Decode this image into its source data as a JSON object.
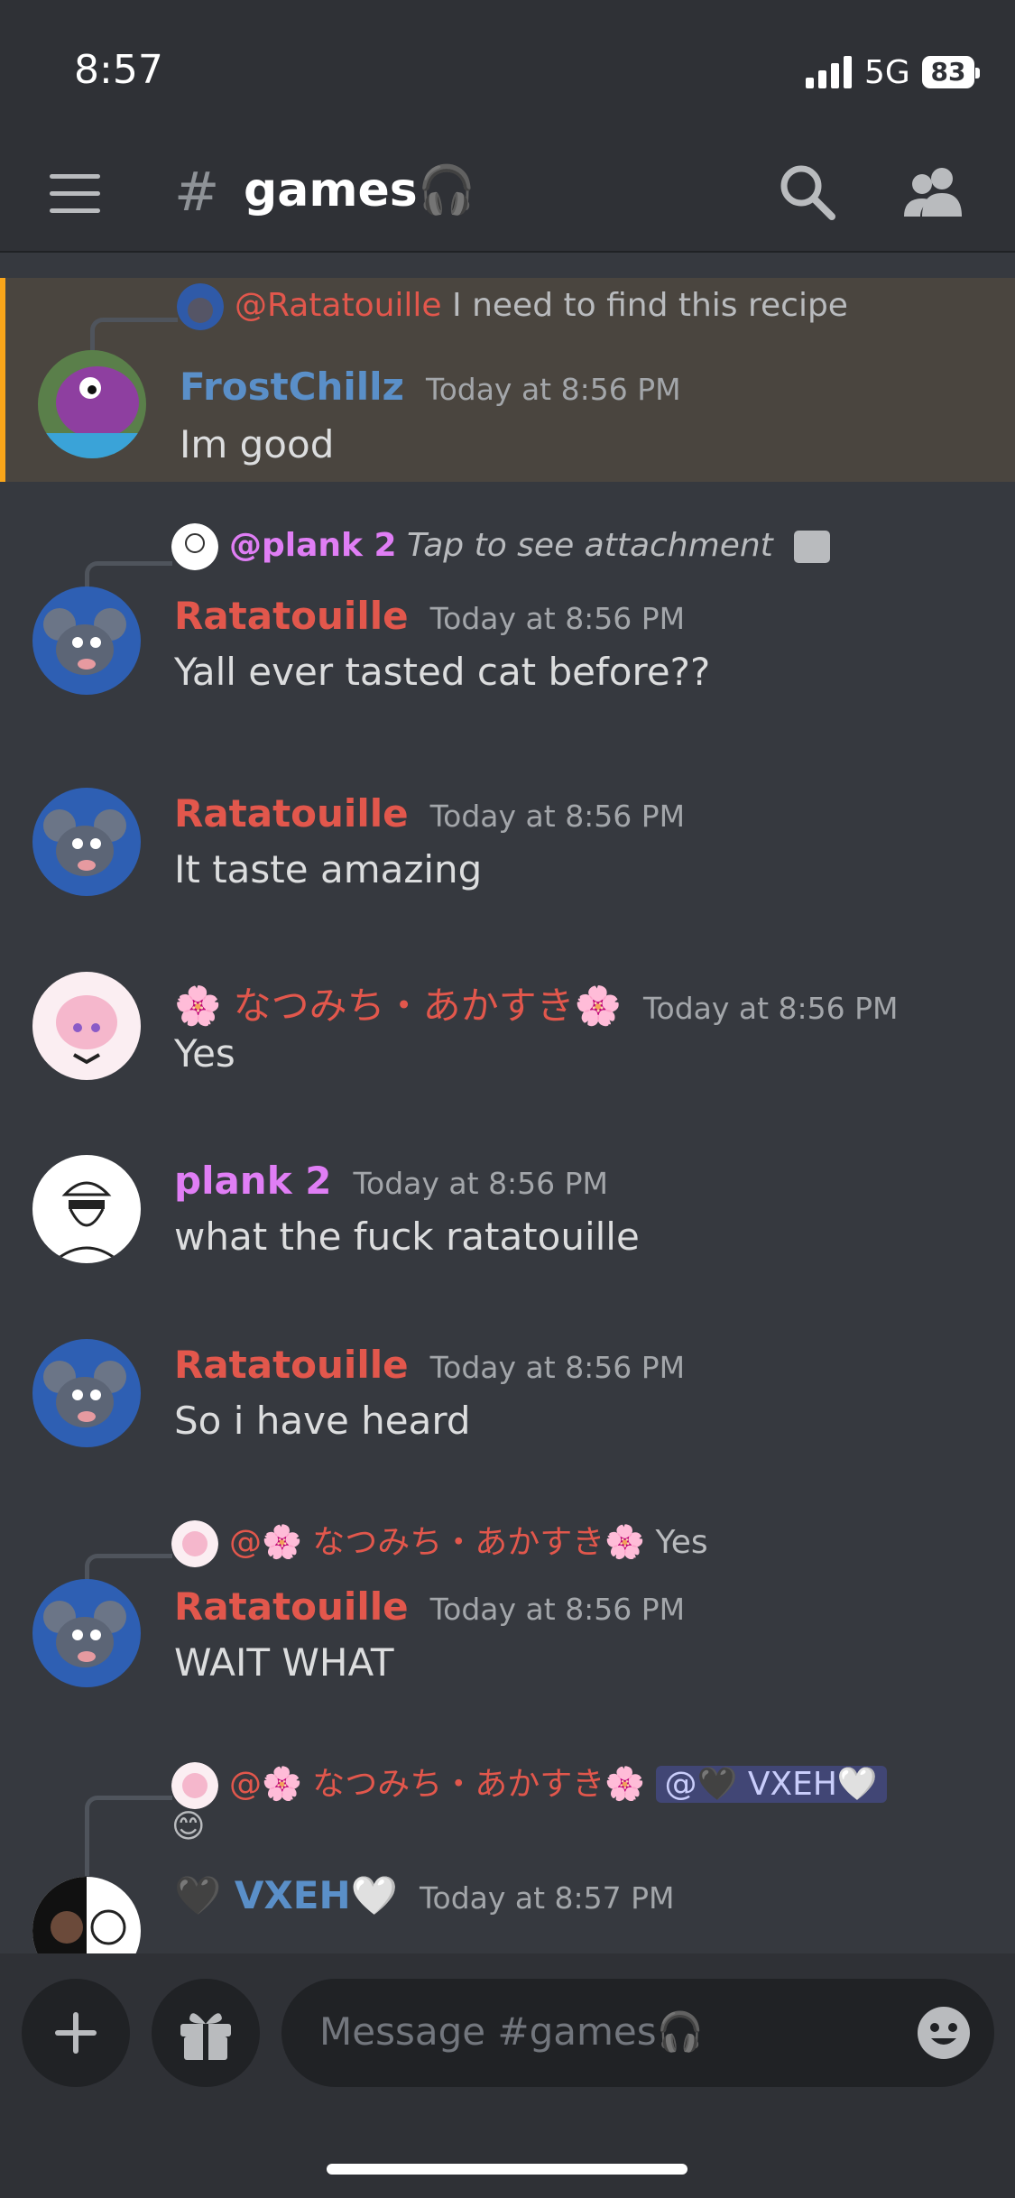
{
  "status_bar": {
    "time": "8:57",
    "network": "5G",
    "battery": "83"
  },
  "header": {
    "channel_name": "games🎧",
    "hash": "#"
  },
  "messages": [
    {
      "reply_to": "@Ratatouille",
      "reply_text": "I need to find this recipe",
      "author": "FrostChillz",
      "timestamp": "Today at 8:56 PM",
      "content": "Im good",
      "highlighted": true
    },
    {
      "reply_to": "@plank 2",
      "reply_text": "Tap to see attachment",
      "author": "Ratatouille",
      "timestamp": "Today at 8:56 PM",
      "content": "Yall ever tasted cat before??"
    },
    {
      "author": "Ratatouille",
      "timestamp": "Today at 8:56 PM",
      "content": "It taste amazing"
    },
    {
      "author": "🌸 なつみち・あかすき🌸",
      "timestamp": "Today at 8:56 PM",
      "content": "Yes"
    },
    {
      "author": "plank 2",
      "timestamp": "Today at 8:56 PM",
      "content": "what the fuck ratatouille"
    },
    {
      "author": "Ratatouille",
      "timestamp": "Today at 8:56 PM",
      "content": "So i have heard"
    },
    {
      "reply_to": "@🌸 なつみち・あかすき🌸",
      "reply_text": "Yes",
      "author": "Ratatouille",
      "timestamp": "Today at 8:56 PM",
      "content": "WAIT WHAT"
    },
    {
      "reply_to": "@🌸 なつみち・あかすき🌸",
      "reply_mention": "@🖤 VXEH🤍",
      "reply_extra": "😊",
      "author": "🖤 VXEH🤍",
      "timestamp": "Today at 8:57 PM",
      "content": ""
    }
  ],
  "composer": {
    "placeholder": "Message #games🎧",
    "plus": "+",
    "gift": "gift",
    "emoji": "emoji"
  },
  "colors": {
    "accent_highlight": "#faa61a",
    "ratatouille": "#e2574c",
    "plank": "#e07ef5",
    "frost": "#5a8fc8"
  }
}
